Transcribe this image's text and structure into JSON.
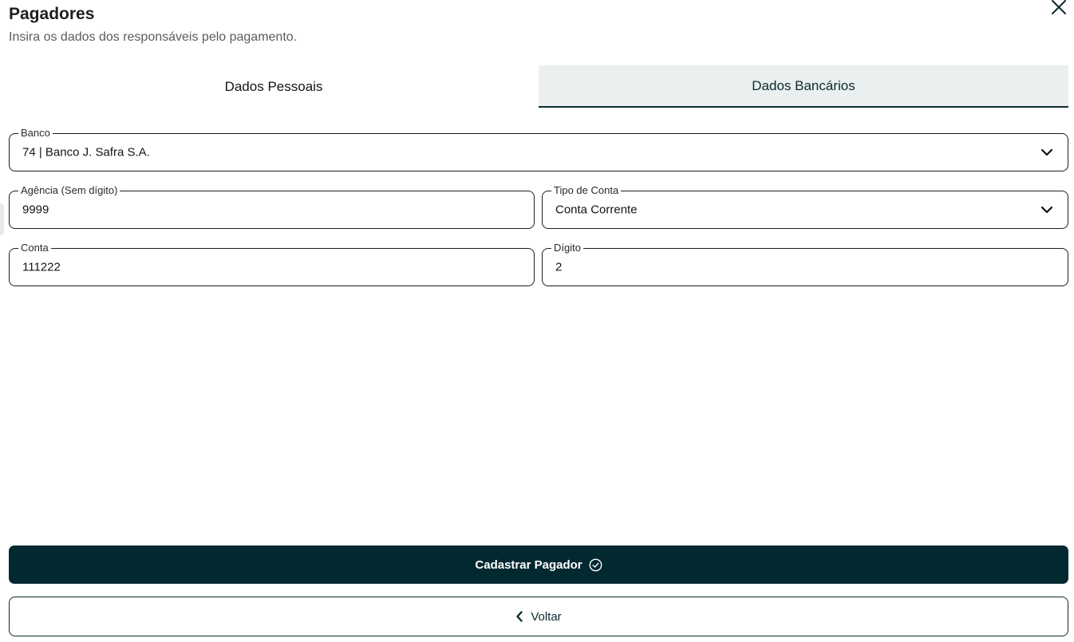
{
  "header": {
    "title": "Pagadores",
    "subtitle": "Insira os dados dos responsáveis pelo pagamento."
  },
  "tabs": [
    {
      "label": "Dados Pessoais",
      "active": false
    },
    {
      "label": "Dados Bancários",
      "active": true
    }
  ],
  "form": {
    "banco": {
      "label": "Banco",
      "value": "74 | Banco J. Safra S.A."
    },
    "agencia": {
      "label": "Agência (Sem dígito)",
      "value": "9999"
    },
    "tipo_conta": {
      "label": "Tipo de Conta",
      "value": "Conta Corrente"
    },
    "conta": {
      "label": "Conta",
      "value": "111222"
    },
    "digito": {
      "label": "Dígito",
      "value": "2"
    }
  },
  "actions": {
    "submit_label": "Cadastrar Pagador",
    "back_label": "Voltar"
  },
  "colors": {
    "primary": "#032930",
    "tab_active_bg": "#eaeff0"
  },
  "icons": {
    "close": "close-icon",
    "dropdown": "chevron-down-icon",
    "submit": "check-circle-icon",
    "back": "chevron-left-icon"
  }
}
